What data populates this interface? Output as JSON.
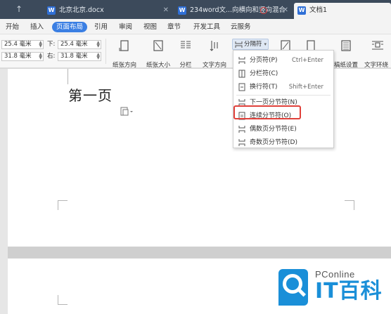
{
  "tabs": [
    {
      "label": "北京北京.docx",
      "icon": "W"
    },
    {
      "label": "234word文...向横向和竖向混合",
      "icon": "W"
    },
    {
      "label": "文档1",
      "icon": "W"
    }
  ],
  "menu": [
    "开始",
    "插入",
    "页面布局",
    "引用",
    "审阅",
    "视图",
    "章节",
    "开发工具",
    "云服务"
  ],
  "margins": {
    "top_value": "25.4 毫米",
    "down_label": "下:",
    "down_value": "25.4 毫米",
    "left_value": "31.8 毫米",
    "right_label": "右:",
    "right_value": "31.8 毫米"
  },
  "toolbar": {
    "orientation": "纸张方向",
    "size": "纸张大小",
    "columns": "分栏",
    "text_direction": "文字方向",
    "breaks": "分隔符",
    "manuscript": "稿纸设置",
    "wrap": "文字环绕"
  },
  "dropdown": {
    "items": [
      {
        "label": "分页符(P)",
        "shortcut": "Ctrl+Enter"
      },
      {
        "label": "分栏符(C)",
        "shortcut": ""
      },
      {
        "label": "换行符(T)",
        "shortcut": "Shift+Enter"
      },
      {
        "label": "下一页分节符(N)",
        "shortcut": ""
      },
      {
        "label": "连续分节符(O)",
        "shortcut": ""
      },
      {
        "label": "偶数页分节符(E)",
        "shortcut": ""
      },
      {
        "label": "奇数页分节符(D)",
        "shortcut": ""
      }
    ]
  },
  "document": {
    "text": "第一页"
  },
  "watermark": {
    "brand": "PConline",
    "main": "IT百科"
  },
  "colors": {
    "accent": "#3b7fe3",
    "highlight": "#e0403a",
    "tabbar": "#3c4a5b",
    "watermark": "#1a8fd8"
  }
}
